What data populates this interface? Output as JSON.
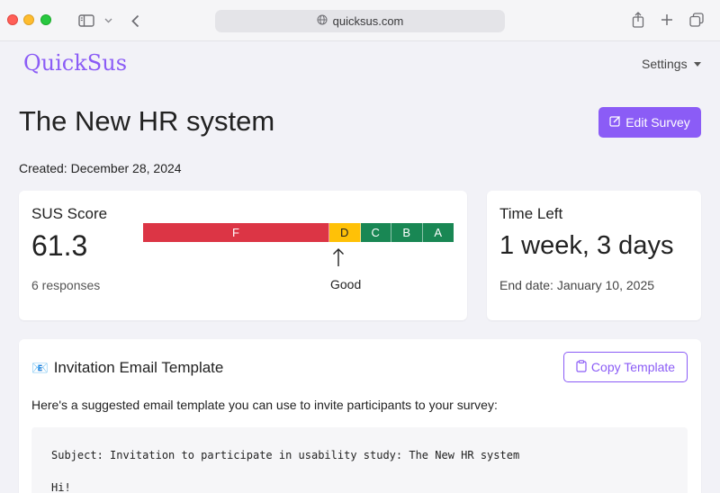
{
  "browser": {
    "url": "quicksus.com"
  },
  "header": {
    "brand": "QuickSus",
    "settings_label": "Settings"
  },
  "survey": {
    "title": "The New HR system",
    "edit_label": "Edit Survey",
    "created": "Created: December 28, 2024"
  },
  "sus": {
    "title": "SUS Score",
    "score": "61.3",
    "responses": "6 responses",
    "marker_label": "Good",
    "grades": [
      {
        "label": "F",
        "share": 0.6,
        "color": "#dc3545"
      },
      {
        "label": "D",
        "share": 0.1,
        "color": "#ffc107"
      },
      {
        "label": "C",
        "share": 0.1,
        "color": "#198754"
      },
      {
        "label": "B",
        "share": 0.1,
        "color": "#198754"
      },
      {
        "label": "A",
        "share": 0.1,
        "color": "#198754"
      }
    ]
  },
  "time": {
    "title": "Time Left",
    "value": "1 week, 3 days",
    "end_date": "End date: January 10, 2025"
  },
  "email": {
    "icon": "📧",
    "title": "Invitation Email Template",
    "copy_label": "Copy Template",
    "intro": "Here's a suggested email template you can use to invite participants to your survey:",
    "body": "Subject: Invitation to participate in usability study: The New HR system\n\nHi!"
  },
  "colors": {
    "accent": "#8b5cf6"
  }
}
